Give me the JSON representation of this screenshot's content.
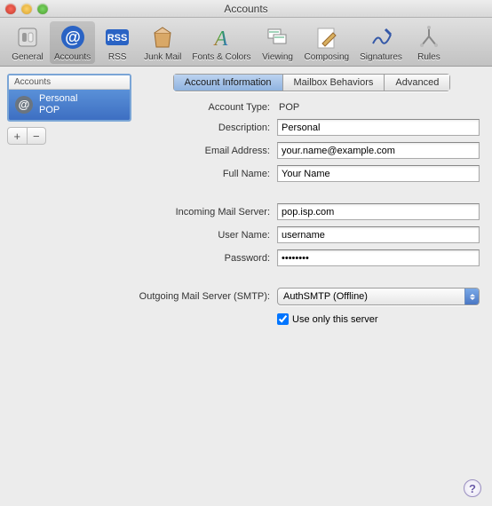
{
  "window": {
    "title": "Accounts"
  },
  "toolbar": {
    "general": "General",
    "accounts": "Accounts",
    "rss": "RSS",
    "junk": "Junk Mail",
    "fonts": "Fonts & Colors",
    "viewing": "Viewing",
    "composing": "Composing",
    "signatures": "Signatures",
    "rules": "Rules"
  },
  "sidebar": {
    "header": "Accounts",
    "items": [
      {
        "name": "Personal",
        "kind": "POP"
      }
    ]
  },
  "tabs": {
    "info": "Account Information",
    "mailbox": "Mailbox Behaviors",
    "advanced": "Advanced"
  },
  "form": {
    "account_type_label": "Account Type:",
    "account_type_value": "POP",
    "description_label": "Description:",
    "description_value": "Personal",
    "email_label": "Email Address:",
    "email_value": "your.name@example.com",
    "fullname_label": "Full Name:",
    "fullname_value": "Your Name",
    "incoming_label": "Incoming Mail Server:",
    "incoming_value": "pop.isp.com",
    "username_label": "User Name:",
    "username_value": "username",
    "password_label": "Password:",
    "password_value": "••••••••",
    "smtp_label": "Outgoing Mail Server (SMTP):",
    "smtp_value": "AuthSMTP (Offline)",
    "useonly_label": "Use only this server"
  },
  "buttons": {
    "add": "+",
    "remove": "−",
    "help": "?"
  }
}
